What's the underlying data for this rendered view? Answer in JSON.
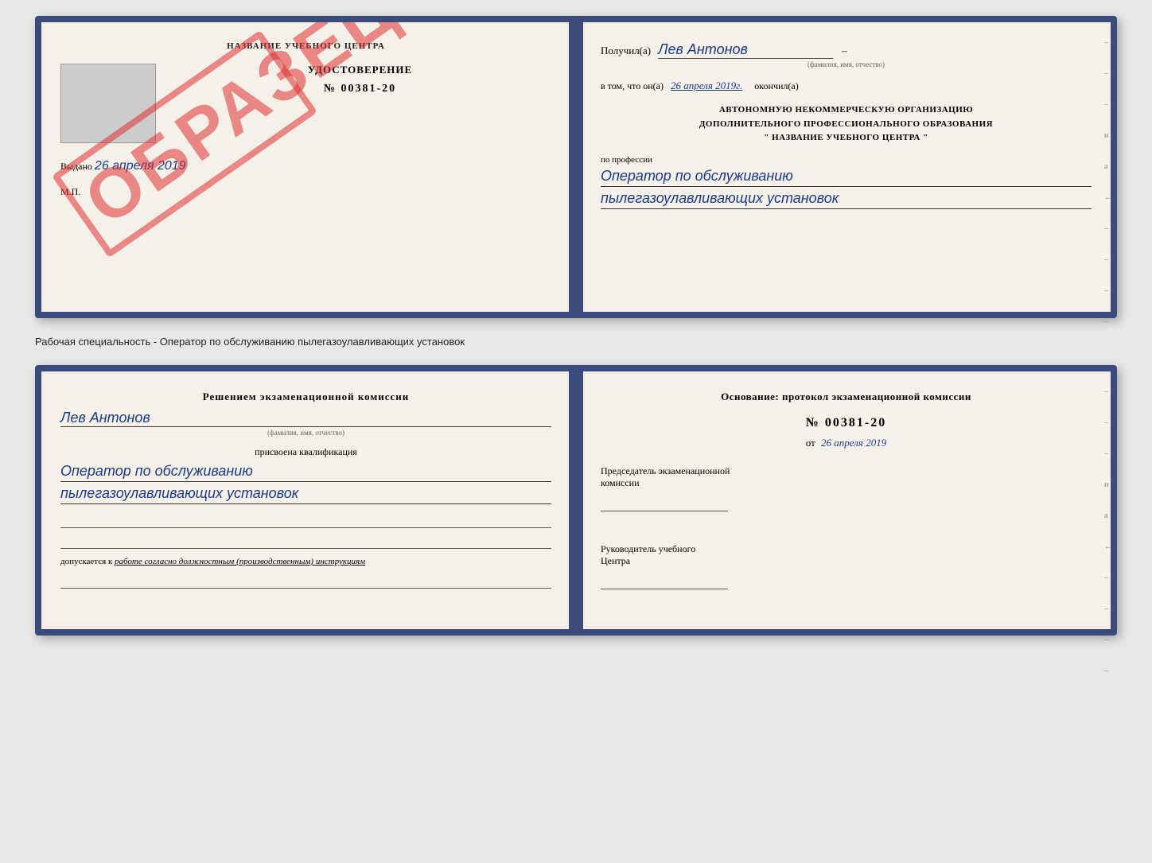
{
  "top_book": {
    "left": {
      "header": "НАЗВАНИЕ УЧЕБНОГО ЦЕНТРА",
      "stamp_watermark": "ОБРАЗЕЦ",
      "cert_title": "УДОСТОВЕРЕНИЕ",
      "cert_number": "№ 00381-20",
      "issued_label": "Выдано",
      "issued_date": "26 апреля 2019",
      "mp_label": "М.П."
    },
    "right": {
      "received_prefix": "Получил(а)",
      "received_name": "Лев Антонов",
      "name_sublabel": "(фамилия, имя, отчество)",
      "date_prefix": "в том, что он(а)",
      "date_value": "26 апреля 2019г.",
      "finished_label": "окончил(а)",
      "org_line1": "АВТОНОМНУЮ НЕКОММЕРЧЕСКУЮ ОРГАНИЗАЦИЮ",
      "org_line2": "ДОПОЛНИТЕЛЬНОГО ПРОФЕССИОНАЛЬНОГО ОБРАЗОВАНИЯ",
      "org_line3": "\"  НАЗВАНИЕ УЧЕБНОГО ЦЕНТРА  \"",
      "profession_label": "по профессии",
      "profession_line1": "Оператор по обслуживанию",
      "profession_line2": "пылегазоулавливающих установок"
    }
  },
  "separator": {
    "text": "Рабочая специальность - Оператор по обслуживанию пылегазоулавливающих установок"
  },
  "bottom_book": {
    "left": {
      "decision_label": "Решением экзаменационной комиссии",
      "name_value": "Лев Антонов",
      "name_sublabel": "(фамилия, имя, отчество)",
      "qualification_label": "присвоена квалификация",
      "qualification_line1": "Оператор по обслуживанию",
      "qualification_line2": "пылегазоулавливающих установок",
      "allowed_prefix": "допускается к",
      "allowed_text": "работе согласно должностным (производственным) инструкциям"
    },
    "right": {
      "basis_label": "Основание: протокол экзаменационной комиссии",
      "protocol_number": "№  00381-20",
      "date_prefix": "от",
      "date_value": "26 апреля 2019",
      "chairman_line1": "Председатель экзаменационной",
      "chairman_line2": "комиссии",
      "director_line1": "Руководитель учебного",
      "director_line2": "Центра"
    }
  },
  "side_marks": [
    "-",
    "-",
    "-",
    "и",
    "а",
    "←",
    "-",
    "-",
    "-",
    "-"
  ]
}
